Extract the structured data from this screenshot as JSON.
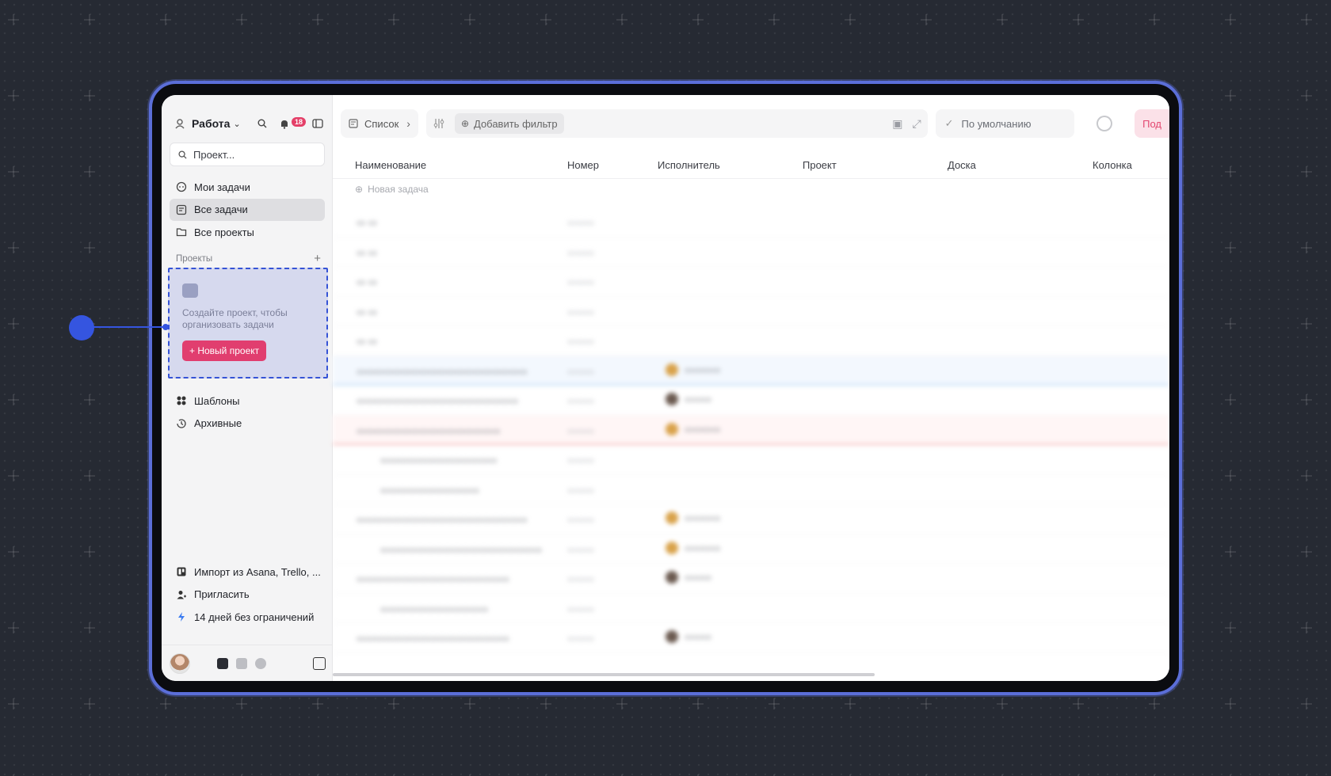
{
  "sidebar": {
    "workspace_name": "Работа",
    "notification_count": "18",
    "search_placeholder": "Проект...",
    "nav": [
      {
        "label": "Мои задачи"
      },
      {
        "label": "Все задачи"
      },
      {
        "label": "Все проекты"
      }
    ],
    "projects_heading": "Проекты",
    "empty_projects_text": "Создайте проект, чтобы организовать задачи",
    "new_project_button": "+ Новый проект",
    "nav2": [
      {
        "label": "Шаблоны"
      },
      {
        "label": "Архивные"
      }
    ],
    "bottom": [
      {
        "label": "Импорт из Asana, Trello, ..."
      },
      {
        "label": "Пригласить"
      },
      {
        "label": "14 дней без ограничений"
      }
    ]
  },
  "toolbar": {
    "view_label": "Список",
    "add_filter_label": "Добавить фильтр",
    "sort_label": "По умолчанию",
    "cta_label": "Под"
  },
  "table": {
    "columns": [
      "Наименование",
      "Номер",
      "Исполнитель",
      "Проект",
      "Доска",
      "Колонка"
    ],
    "new_task_label": "Новая задача"
  },
  "colors": {
    "accent": "#e13e6f",
    "annotation": "#3555e0",
    "frame": "#5b6ed8"
  }
}
